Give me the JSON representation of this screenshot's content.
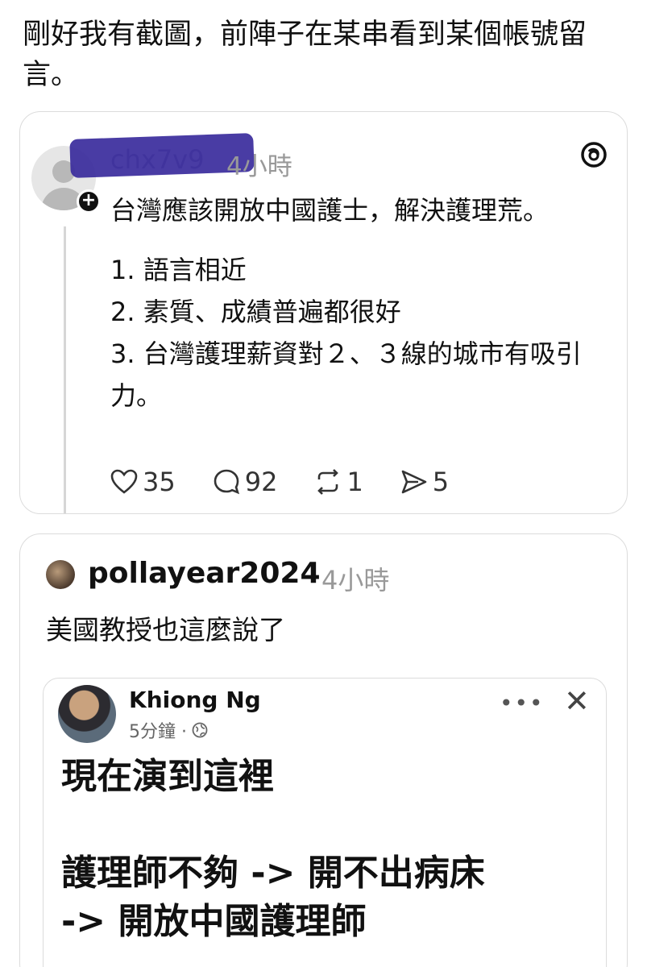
{
  "intro": {
    "text": "剛好我有截圖，前陣子在某串看到某個帳號留言。"
  },
  "post1": {
    "username": "chx7v9",
    "time": "4小時",
    "lines": [
      "台灣應該開放中國護士，解決護理荒。",
      "1. 語言相近",
      "2. 素質、成績普遍都很好",
      "3. 台灣護理薪資對２、３線的城市有吸引力。"
    ],
    "likes": "35",
    "comments": "92",
    "reposts": "1",
    "shares": "5"
  },
  "post2": {
    "username": "pollayear2024",
    "time": "4小時",
    "text": "美國教授也這麼說了",
    "embed": {
      "name": "Khiong Ng",
      "meta": "5分鐘 ·",
      "line1": "現在演到這裡",
      "line2": "護理師不夠 -> 開不出病床",
      "line3": "-> 開放中國護理師"
    }
  },
  "colors": {
    "redaction": "#3a2b9c",
    "muted": "#999999",
    "border": "#dcdcdc"
  }
}
